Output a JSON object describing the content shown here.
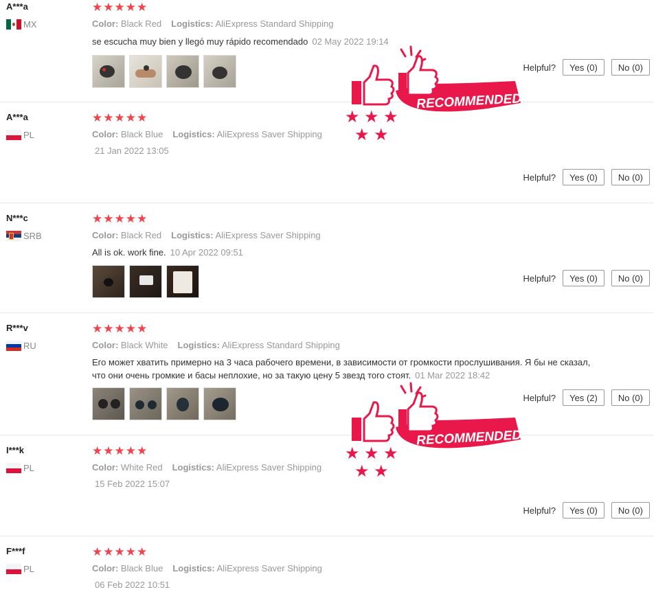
{
  "labels": {
    "color": "Color:",
    "logistics": "Logistics:",
    "helpful": "Helpful?"
  },
  "badge": {
    "text": "RECOMMENDED",
    "color": "#e8194a"
  },
  "colors": {
    "star": "#f0434a",
    "muted": "#999999"
  },
  "reviews": [
    {
      "user": "A***a",
      "country": "MX",
      "flag": "mx",
      "stars": "★★★★★",
      "color": "Black Red",
      "logistics": "AliExpress Standard Shipping",
      "text": "se escucha muy bien y llegó muy rápido recomendado",
      "date": "02 May 2022 19:14",
      "yes": "Yes (0)",
      "no": "No (0)",
      "photos": 4
    },
    {
      "user": "A***a",
      "country": "PL",
      "flag": "pl",
      "stars": "★★★★★",
      "color": "Black Blue",
      "logistics": "AliExpress Saver Shipping",
      "text": "",
      "date": "21 Jan 2022 13:05",
      "yes": "Yes (0)",
      "no": "No (0)",
      "photos": 0
    },
    {
      "user": "N***c",
      "country": "SRB",
      "flag": "rs",
      "stars": "★★★★★",
      "color": "Black Red",
      "logistics": "AliExpress Saver Shipping",
      "text": "All is ok. work fine.",
      "date": "10 Apr 2022 09:51",
      "yes": "Yes (0)",
      "no": "No (0)",
      "photos": 3
    },
    {
      "user": "R***v",
      "country": "RU",
      "flag": "ru",
      "stars": "★★★★★",
      "color": "Black White",
      "logistics": "AliExpress Standard Shipping",
      "text": "Его может хватить примерно на 3 часа рабочего времени, в зависимости от громкости прослушивания. Я бы не сказал, что они очень громкие и басы неплохие, но за такую цену 5 звезд того стоят.",
      "date": "01 Mar 2022 18:42",
      "yes": "Yes (2)",
      "no": "No (0)",
      "photos": 4
    },
    {
      "user": "I***k",
      "country": "PL",
      "flag": "pl",
      "stars": "★★★★★",
      "color": "White Red",
      "logistics": "AliExpress Saver Shipping",
      "text": "",
      "date": "15 Feb 2022 15:07",
      "yes": "Yes (0)",
      "no": "No (0)",
      "photos": 0
    },
    {
      "user": "F***f",
      "country": "PL",
      "flag": "pl",
      "stars": "★★★★★",
      "color": "Black Blue",
      "logistics": "AliExpress Saver Shipping",
      "text": "",
      "date": "06 Feb 2022 10:51",
      "yes": "",
      "no": "",
      "photos": 0
    }
  ]
}
